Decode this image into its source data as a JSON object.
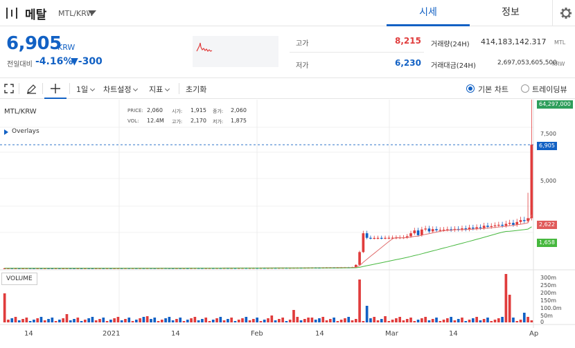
{
  "header": {
    "coin_name": "메탈",
    "pair": "MTL/KRW",
    "tabs": [
      "시세",
      "정보"
    ]
  },
  "price": {
    "current": "6,905",
    "unit": "KRW",
    "prev_label": "전일대비",
    "change_pct": "-4.16%",
    "change_abs": "▼-300"
  },
  "stats": {
    "high_label": "고가",
    "high_value": "8,215",
    "low_label": "저가",
    "low_value": "6,230",
    "volume_label": "거래량(24H)",
    "volume_value": "414,183,142.317",
    "volume_unit": "MTL",
    "amount_label": "거래대금(24H)",
    "amount_value": "2,697,053,605,500",
    "amount_unit": "KRW"
  },
  "toolbar": {
    "interval": "1일",
    "chart_settings": "차트설정",
    "indicators": "지표",
    "reset": "초기화",
    "basic_chart": "기본 차트",
    "trading_view": "트레이딩뷰"
  },
  "chart_legend": {
    "pair": "MTL/KRW",
    "overlays": "Overlays",
    "price_k": "PRICE:",
    "price_v": "2,060",
    "open_k": "시가:",
    "open_v": "1,915",
    "close_k": "종가:",
    "close_v": "2,060",
    "vol_k": "VOL:",
    "vol_v": "12.4M",
    "high_k": "고가:",
    "high_v": "2,170",
    "low_k": "저가:",
    "low_v": "1,875",
    "volume_box": "VOLUME"
  },
  "colors": {
    "up": "#e03c3c",
    "down": "#1261c4",
    "ma_short": "#e06c6c",
    "ma_long": "#46b83e"
  },
  "chart_data": {
    "type": "candlestick",
    "price_axis": {
      "labels": [
        "7,500",
        "5,000"
      ],
      "values": [
        7500,
        5000
      ]
    },
    "volume_axis": {
      "labels": [
        "300m",
        "250m",
        "200m",
        "150m",
        "100.0m",
        "50m",
        "0"
      ]
    },
    "price_tags": [
      {
        "label": "64,297,000",
        "color": "#2e9e5b"
      },
      {
        "label": "6,905",
        "color": "#1261c4"
      },
      {
        "label": "2,622",
        "color": "#e05b5b"
      },
      {
        "label": "1,658",
        "color": "#3eb43e"
      }
    ],
    "x_labels": [
      "14",
      "2021",
      "14",
      "Feb",
      "14",
      "Mar",
      "14",
      "Ap"
    ],
    "close": [
      340,
      342,
      338,
      341,
      339,
      340,
      343,
      341,
      340,
      342,
      339,
      341,
      340,
      338,
      342,
      340,
      341,
      343,
      340,
      339,
      341,
      340,
      342,
      340,
      339,
      341,
      343,
      342,
      344,
      341,
      343,
      345,
      342,
      346,
      344,
      347,
      345,
      348,
      346,
      349,
      347,
      346,
      348,
      350,
      348,
      347,
      346,
      348,
      347,
      349,
      348,
      350,
      352,
      351,
      349,
      350,
      352,
      351,
      353,
      352,
      354,
      351,
      353,
      352,
      354,
      356,
      353,
      355,
      357,
      356,
      358,
      356,
      358,
      360,
      359,
      361,
      363,
      360,
      362,
      365,
      367,
      366,
      368,
      370,
      372,
      371,
      369,
      374,
      377,
      380,
      378,
      382,
      385,
      388,
      386,
      400,
      520,
      1200,
      2200,
      1958,
      1950,
      1952,
      1955,
      1953,
      1957,
      1960,
      1965,
      1972,
      1975,
      1980,
      2040,
      2200,
      2350,
      2100,
      2400,
      2450,
      2300,
      2420,
      2360,
      2380,
      2390,
      2410,
      2370,
      2430,
      2390,
      2460,
      2400,
      2500,
      2450,
      2520,
      2480,
      2600,
      2540,
      2580,
      2620,
      2650,
      2600,
      2700,
      2750,
      2650,
      2800,
      2900,
      2850,
      3000,
      6905
    ]
  }
}
